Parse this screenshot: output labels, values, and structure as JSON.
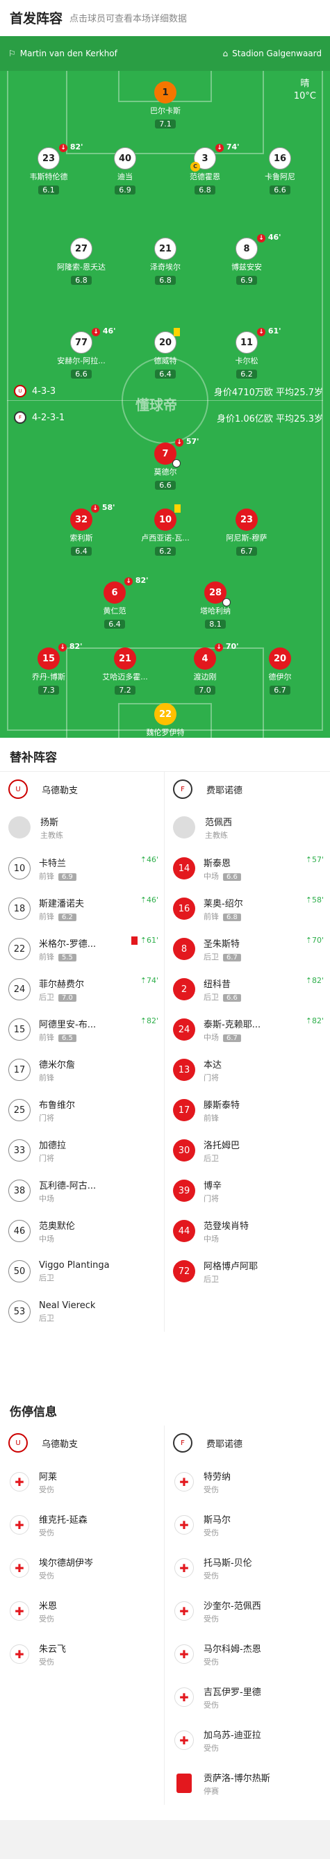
{
  "header": {
    "title": "首发阵容",
    "subtitle": "点击球员可查看本场详细数据"
  },
  "pitch": {
    "home_coach": "Martin van den Kerkhof",
    "stadium": "Stadion Galgenwaard",
    "weather": "晴",
    "temperature": "10°C",
    "watermark": "懂球帝",
    "home_formation": "4-3-3",
    "away_formation": "4-2-3-1",
    "home_value": "身价4710万欧  平均25.7岁",
    "away_value": "身价1.06亿欧  平均25.3岁"
  },
  "home_players": [
    {
      "num": "1",
      "name": "巴尔卡斯",
      "rating": "7.1",
      "cls": "o"
    },
    {
      "num": "23",
      "name": "韦斯特伦德",
      "rating": "6.1",
      "cls": "w",
      "sub": "82'"
    },
    {
      "num": "40",
      "name": "迪当",
      "rating": "6.9",
      "cls": "w"
    },
    {
      "num": "3",
      "name": "范德霍恩",
      "rating": "6.8",
      "cls": "w",
      "sub": "74'",
      "cap": "C"
    },
    {
      "num": "16",
      "name": "卡鲁阿尼",
      "rating": "6.6",
      "cls": "w"
    },
    {
      "num": "27",
      "name": "阿隆索-恩夭达",
      "rating": "6.8",
      "cls": "w"
    },
    {
      "num": "21",
      "name": "泽奇埃尔",
      "rating": "6.8",
      "cls": "w"
    },
    {
      "num": "8",
      "name": "博兹安安",
      "rating": "6.9",
      "cls": "w",
      "sub": "46'"
    },
    {
      "num": "77",
      "name": "安赫尔-阿拉...",
      "rating": "6.6",
      "cls": "w",
      "sub": "46'"
    },
    {
      "num": "20",
      "name": "德威特",
      "rating": "6.4",
      "cls": "w",
      "yellow": true
    },
    {
      "num": "11",
      "name": "卡尔松",
      "rating": "6.2",
      "cls": "w",
      "sub": "61'"
    }
  ],
  "away_players": [
    {
      "num": "7",
      "name": "莫德尔",
      "rating": "6.6",
      "cls": "r",
      "sub": "57'",
      "ball": true
    },
    {
      "num": "32",
      "name": "索利斯",
      "rating": "6.4",
      "cls": "r",
      "sub": "58'"
    },
    {
      "num": "10",
      "name": "卢西亚诺-瓦...",
      "rating": "6.2",
      "cls": "r",
      "yellow": true
    },
    {
      "num": "23",
      "name": "阿尼斯-穆萨",
      "rating": "6.7",
      "cls": "r"
    },
    {
      "num": "6",
      "name": "黄仁范",
      "rating": "6.4",
      "cls": "r",
      "sub": "82'"
    },
    {
      "num": "28",
      "name": "塔哈利纳",
      "rating": "8.1",
      "cls": "r",
      "ball": true
    },
    {
      "num": "15",
      "name": "乔丹-博斯",
      "rating": "7.3",
      "cls": "r",
      "sub": "82'"
    },
    {
      "num": "21",
      "name": "艾哈迈多霍...",
      "rating": "7.2",
      "cls": "r"
    },
    {
      "num": "4",
      "name": "渡边刚",
      "rating": "7.0",
      "cls": "r",
      "sub": "70'"
    },
    {
      "num": "20",
      "name": "德伊尔",
      "rating": "6.7",
      "cls": "r"
    },
    {
      "num": "22",
      "name": "魏伦罗伊特",
      "rating": "8.7",
      "cls": "gk",
      "star": "★"
    }
  ],
  "subs": {
    "title": "替补阵容",
    "home_team": "乌德勒支",
    "away_team": "费耶诺德",
    "home_coach": "扬斯",
    "away_coach": "范佩西",
    "coach_label": "主教练",
    "home": [
      {
        "num": "10",
        "name": "卡特兰",
        "pos": "前锋",
        "rating": "6.9",
        "in": "46'"
      },
      {
        "num": "18",
        "name": "斯建潘诺夫",
        "pos": "前锋",
        "rating": "6.2",
        "in": "46'"
      },
      {
        "num": "22",
        "name": "米格尔-罗德...",
        "pos": "前锋",
        "rating": "5.5",
        "in": "61'",
        "red": true
      },
      {
        "num": "24",
        "name": "菲尔赫费尔",
        "pos": "后卫",
        "rating": "7.0",
        "in": "74'"
      },
      {
        "num": "15",
        "name": "阿德里安-布...",
        "pos": "前锋",
        "rating": "6.5",
        "in": "82'"
      },
      {
        "num": "17",
        "name": "德米尔詹",
        "pos": "前锋"
      },
      {
        "num": "25",
        "name": "布鲁维尔",
        "pos": "门将"
      },
      {
        "num": "33",
        "name": "加德拉",
        "pos": "门将"
      },
      {
        "num": "38",
        "name": "瓦利德-阿古...",
        "pos": "中场"
      },
      {
        "num": "46",
        "name": "范奥默伦",
        "pos": "中场"
      },
      {
        "num": "50",
        "name": "Viggo Plantinga",
        "pos": "后卫"
      },
      {
        "num": "53",
        "name": "Neal Viereck",
        "pos": "后卫"
      }
    ],
    "away": [
      {
        "num": "14",
        "name": "斯泰恩",
        "pos": "中场",
        "rating": "6.6",
        "in": "57'"
      },
      {
        "num": "16",
        "name": "莱奥-绍尔",
        "pos": "前锋",
        "rating": "6.8",
        "in": "58'"
      },
      {
        "num": "8",
        "name": "圣朱斯特",
        "pos": "后卫",
        "rating": "6.7",
        "in": "70'"
      },
      {
        "num": "2",
        "name": "纽科昔",
        "pos": "后卫",
        "rating": "6.6",
        "in": "82'"
      },
      {
        "num": "24",
        "name": "泰斯-克赖耶...",
        "pos": "中场",
        "rating": "6.7",
        "in": "82'"
      },
      {
        "num": "13",
        "name": "本达",
        "pos": "门将"
      },
      {
        "num": "17",
        "name": "滕斯泰特",
        "pos": "前锋"
      },
      {
        "num": "30",
        "name": "洛托姆巴",
        "pos": "后卫"
      },
      {
        "num": "39",
        "name": "博辛",
        "pos": "门将"
      },
      {
        "num": "44",
        "name": "范登埃肖特",
        "pos": "中场"
      },
      {
        "num": "72",
        "name": "阿格博卢阿耶",
        "pos": "后卫"
      }
    ]
  },
  "injuries": {
    "title": "伤停信息",
    "home": [
      {
        "name": "阿莱",
        "status": "受伤"
      },
      {
        "name": "维克托-延森",
        "status": "受伤"
      },
      {
        "name": "埃尔德胡伊岑",
        "status": "受伤"
      },
      {
        "name": "米恩",
        "status": "受伤"
      },
      {
        "name": "朱云飞",
        "status": "受伤"
      }
    ],
    "away": [
      {
        "name": "特劳纳",
        "status": "受伤"
      },
      {
        "name": "斯马尔",
        "status": "受伤"
      },
      {
        "name": "托马斯-贝伦",
        "status": "受伤"
      },
      {
        "name": "沙奎尔-范佩西",
        "status": "受伤"
      },
      {
        "name": "马尔科姆-杰恩",
        "status": "受伤"
      },
      {
        "name": "吉瓦伊罗-里德",
        "status": "受伤"
      },
      {
        "name": "加乌苏-迪亚拉",
        "status": "受伤"
      },
      {
        "name": "贡萨洛-博尔热斯",
        "status": "停赛",
        "red": true
      }
    ]
  }
}
